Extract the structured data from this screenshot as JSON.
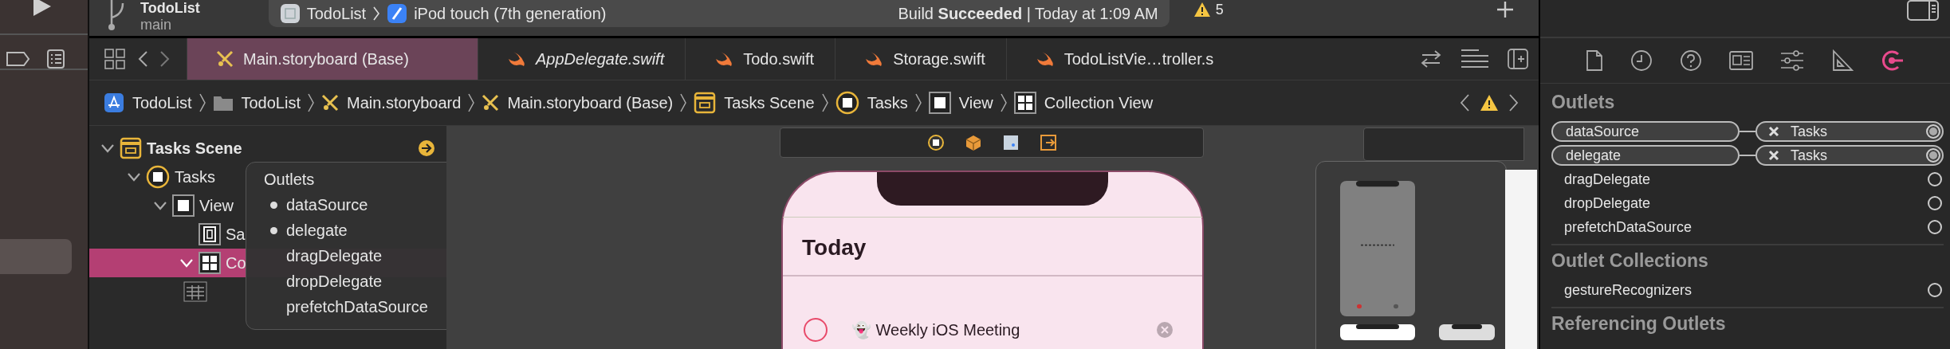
{
  "toolbar": {
    "project": "TodoList",
    "branch": "main",
    "scheme": "TodoList",
    "device": "iPod touch (7th generation)",
    "status": "Build **Succeeded** | Today at 1:09 AM",
    "warnings": "5"
  },
  "tabs": [
    {
      "label": "Main.storyboard (Base)",
      "kind": "storyboard",
      "selected": true,
      "preview": false
    },
    {
      "label": "AppDelegate.swift",
      "kind": "swift",
      "selected": false,
      "preview": true
    },
    {
      "label": "Todo.swift",
      "kind": "swift",
      "selected": false,
      "preview": false
    },
    {
      "label": "Storage.swift",
      "kind": "swift",
      "selected": false,
      "preview": false
    },
    {
      "label": "TodoListVie…troller.s",
      "kind": "swift",
      "selected": false,
      "preview": false
    }
  ],
  "breadcrumb": [
    {
      "label": "TodoList",
      "kind": "project"
    },
    {
      "label": "TodoList",
      "kind": "folder"
    },
    {
      "label": "Main.storyboard",
      "kind": "storyboard"
    },
    {
      "label": "Main.storyboard (Base)",
      "kind": "storyboard"
    },
    {
      "label": "Tasks Scene",
      "kind": "scene"
    },
    {
      "label": "Tasks",
      "kind": "controller"
    },
    {
      "label": "View",
      "kind": "view"
    },
    {
      "label": "Collection View",
      "kind": "collection"
    }
  ],
  "outline": [
    {
      "label": "Tasks Scene",
      "kind": "scene",
      "expanded": true,
      "selected": false,
      "children": [
        {
          "label": "Tasks",
          "kind": "controller",
          "expanded": true,
          "selected": false,
          "children": [
            {
              "label": "View",
              "kind": "view",
              "expanded": true,
              "selected": false,
              "children": [
                {
                  "label": "Sa",
                  "kind": "safe",
                  "expanded": false,
                  "selected": false
                },
                {
                  "label": "Co",
                  "kind": "collection",
                  "expanded": true,
                  "selected": true
                }
              ]
            }
          ]
        }
      ]
    }
  ],
  "popover": {
    "title": "Outlets",
    "items": [
      {
        "label": "dataSource",
        "connected": true
      },
      {
        "label": "delegate",
        "connected": true
      },
      {
        "label": "dragDelegate",
        "connected": false
      },
      {
        "label": "dropDelegate",
        "connected": false
      },
      {
        "label": "prefetchDataSource",
        "connected": false
      }
    ]
  },
  "phone": {
    "header": "Today",
    "tasks": [
      {
        "title": "👻 Weekly iOS Meeting",
        "done": false
      }
    ]
  },
  "inspector": {
    "sections": [
      {
        "title": "Outlets",
        "rows": [
          {
            "name": "dataSource",
            "connected": true,
            "target": "Tasks"
          },
          {
            "name": "delegate",
            "connected": true,
            "target": "Tasks"
          },
          {
            "name": "dragDelegate",
            "connected": false
          },
          {
            "name": "dropDelegate",
            "connected": false
          },
          {
            "name": "prefetchDataSource",
            "connected": false
          }
        ]
      },
      {
        "title": "Outlet Collections",
        "rows": [
          {
            "name": "gestureRecognizers",
            "connected": false
          }
        ]
      },
      {
        "title": "Referencing Outlets"
      }
    ]
  }
}
